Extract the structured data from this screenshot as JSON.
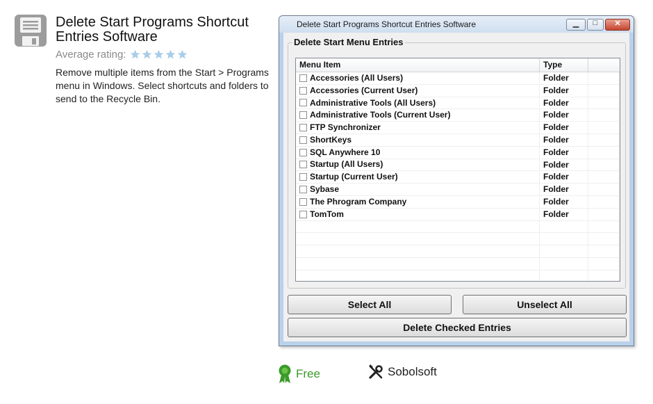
{
  "app": {
    "title": "Delete Start Programs Shortcut Entries Software",
    "rating_label": "Average rating:",
    "rating_value": 0,
    "rating_max": 5,
    "description": "Remove multiple items from the Start > Programs menu in Windows. Select shortcuts and folders to send to the Recycle Bin.",
    "icon": "floppy-disk-icon"
  },
  "window": {
    "title": "Delete Start Programs Shortcut Entries Software",
    "controls": {
      "minimize": "minimize-icon",
      "maximize": "maximize-icon",
      "close": "close-icon"
    },
    "group_label": "Delete Start Menu Entries",
    "columns": [
      "Menu Item",
      "Type",
      ""
    ],
    "rows": [
      {
        "item": "Accessories (All Users)",
        "type": "Folder",
        "checked": false
      },
      {
        "item": "Accessories (Current User)",
        "type": "Folder",
        "checked": false
      },
      {
        "item": "Administrative Tools (All Users)",
        "type": "Folder",
        "checked": false
      },
      {
        "item": "Administrative Tools (Current User)",
        "type": "Folder",
        "checked": false
      },
      {
        "item": "FTP Synchronizer",
        "type": "Folder",
        "checked": false
      },
      {
        "item": "ShortKeys",
        "type": "Folder",
        "checked": false
      },
      {
        "item": "SQL Anywhere 10",
        "type": "Folder",
        "checked": false
      },
      {
        "item": "Startup (All Users)",
        "type": "Folder",
        "checked": false
      },
      {
        "item": "Startup (Current User)",
        "type": "Folder",
        "checked": false
      },
      {
        "item": "Sybase",
        "type": "Folder",
        "checked": false
      },
      {
        "item": "The Phrogram Company",
        "type": "Folder",
        "checked": false
      },
      {
        "item": "TomTom",
        "type": "Folder",
        "checked": false
      }
    ],
    "buttons": {
      "select_all": "Select All",
      "unselect_all": "Unselect All",
      "delete_checked": "Delete Checked Entries"
    }
  },
  "footer": {
    "license": "Free",
    "license_icon": "award-ribbon-icon",
    "publisher": "Sobolsoft",
    "publisher_icon": "tools-icon"
  },
  "colors": {
    "free_green": "#3a9a2a",
    "star_blue": "#a9cde8",
    "window_frame": "#b9d1ea"
  }
}
